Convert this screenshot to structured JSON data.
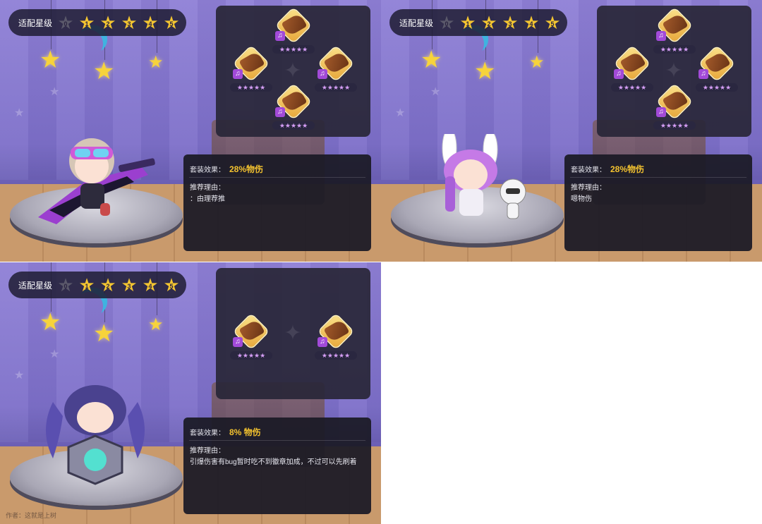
{
  "star_bar_label": "适配星级",
  "rank_numbers": [
    "0",
    "1",
    "2",
    "3",
    "4",
    "5"
  ],
  "slot_stars": "★★★★★",
  "slot_icon_glyph": "♫",
  "set_effect_label": "套装效果：",
  "reason_label": "推荐理由：",
  "panels": [
    {
      "name": "panel-1",
      "active_ranks": 5,
      "set_effect": "28%物伤",
      "reason": "：由理荐推",
      "slots": 4
    },
    {
      "name": "panel-2",
      "active_ranks": 5,
      "set_effect": "28%物伤",
      "reason": "嗯物伤",
      "slots": 4
    },
    {
      "name": "panel-3",
      "active_ranks": 5,
      "set_effect": "8% 物伤",
      "reason": "引爆伤害有bug暂时吃不到徽章加成，不过可以先刷着",
      "slots": 2
    }
  ],
  "author_text": "作者：这就是上树",
  "colors": {
    "accent_gold": "#f3c22f",
    "bar_bg": "#1e1c32",
    "panel_bg": "#8e7fd6"
  }
}
